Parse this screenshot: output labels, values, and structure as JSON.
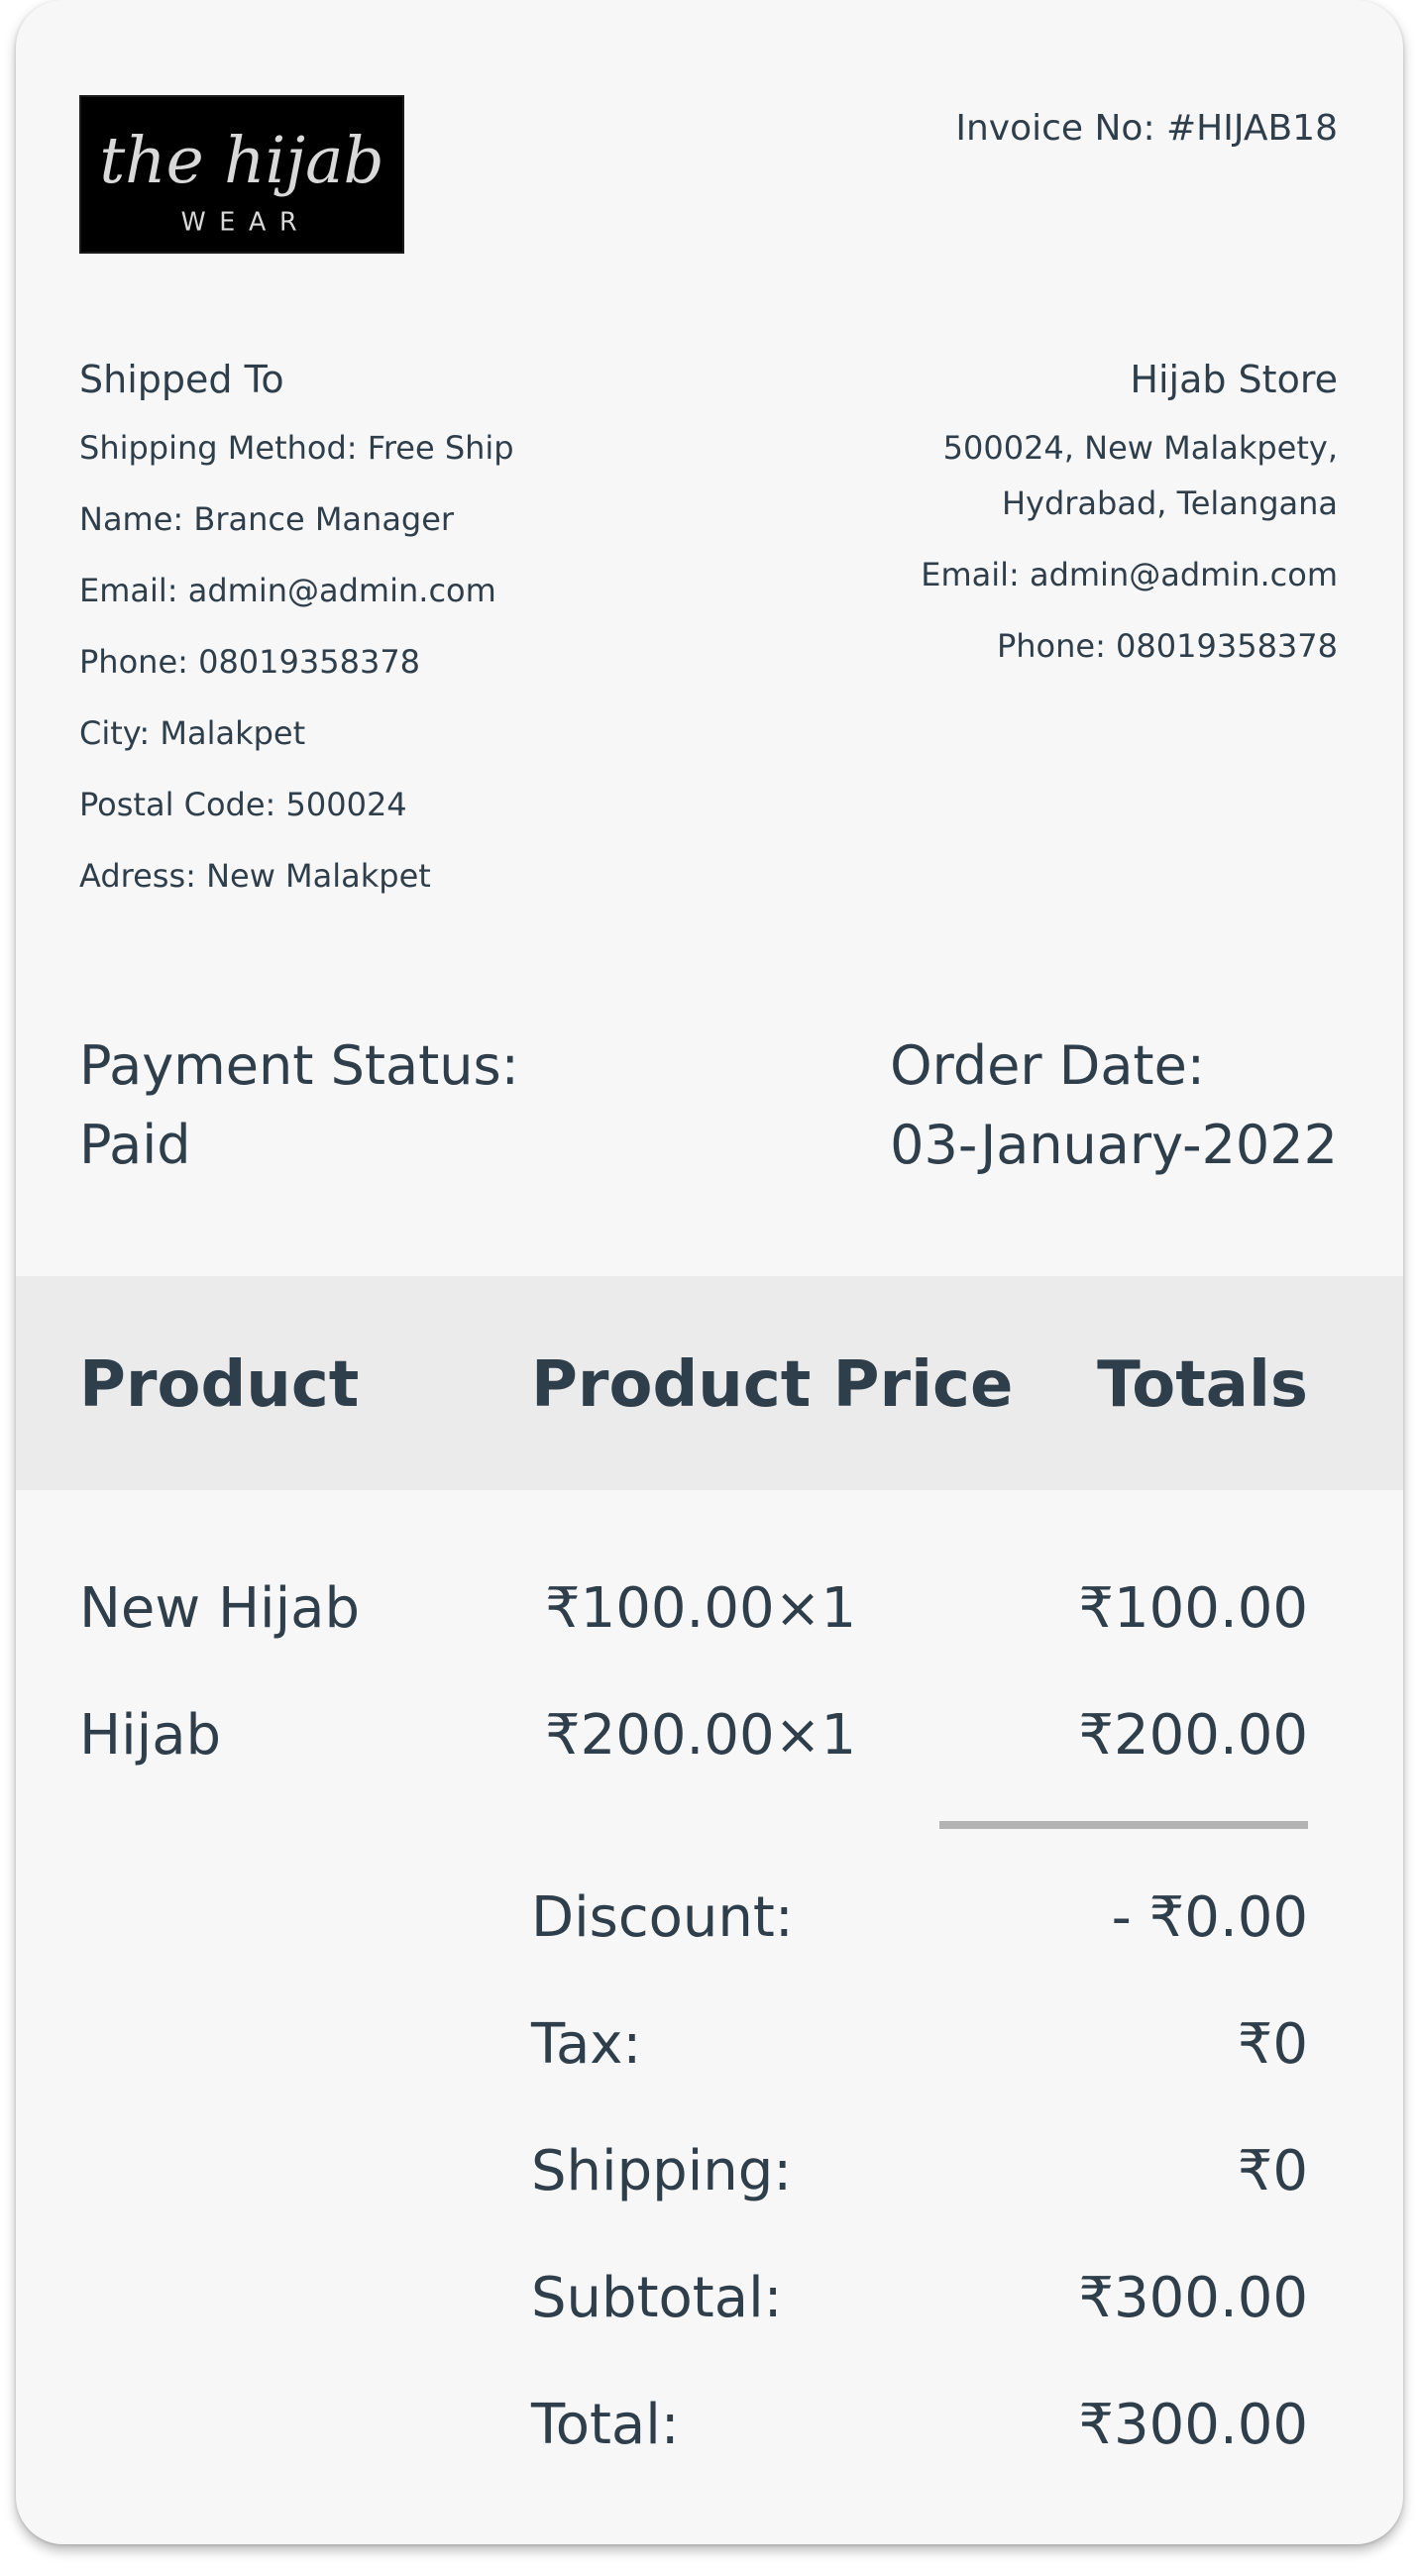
{
  "logo": {
    "text_line1": "the hijab",
    "text_line2": "WEAR",
    "background": "#000000",
    "foreground": "#e6e6e6"
  },
  "invoice": {
    "number_label": "Invoice No: #HIJAB18"
  },
  "shipped_to": {
    "heading": "Shipped To",
    "shipping_method": "Shipping Method: Free Ship",
    "name": "Name: Brance Manager",
    "email": "Email: admin@admin.com",
    "phone": "Phone: 08019358378",
    "city": "City: Malakpet",
    "postal_code": "Postal Code: 500024",
    "address": "Adress: New Malakpet"
  },
  "store": {
    "heading": "Hijab Store",
    "address_line1": "500024, New Malakpety,",
    "address_line2": "Hydrabad, Telangana",
    "email": "Email: admin@admin.com",
    "phone": "Phone: 08019358378"
  },
  "payment": {
    "label": "Payment Status:",
    "value": "Paid"
  },
  "order": {
    "label": "Order Date:",
    "value": "03-January-2022"
  },
  "table": {
    "headers": {
      "product": "Product",
      "price": "Product Price",
      "totals": "Totals"
    },
    "rows": [
      {
        "product": "New Hijab",
        "price": "₹100.00×1",
        "total": "₹100.00"
      },
      {
        "product": "Hijab",
        "price": "₹200.00×1",
        "total": "₹200.00"
      }
    ]
  },
  "summary": {
    "discount_label": "Discount:",
    "discount_value": "- ₹0.00",
    "tax_label": "Tax:",
    "tax_value": "₹0",
    "shipping_label": "Shipping:",
    "shipping_value": "₹0",
    "subtotal_label": "Subtotal:",
    "subtotal_value": "₹300.00",
    "total_label": "Total:",
    "total_value": "₹300.00"
  },
  "colors": {
    "text": "#2e3e4b",
    "card_background": "#f7f7f7",
    "header_band": "#ebebeb",
    "divider": "#b3b3b3"
  }
}
